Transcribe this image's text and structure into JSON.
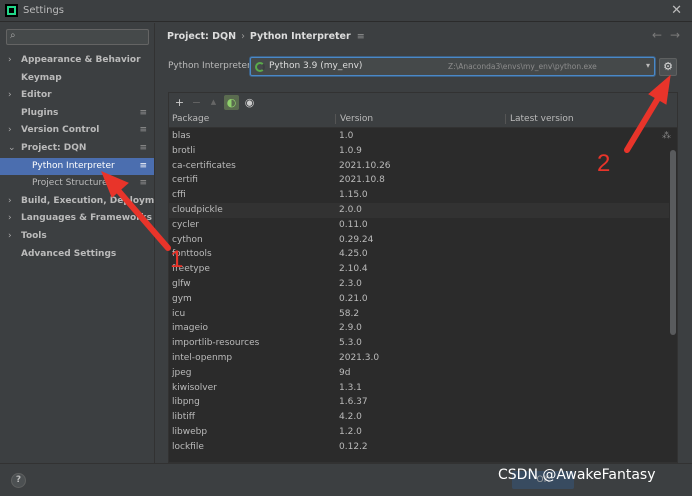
{
  "window": {
    "title": "Settings",
    "close_glyph": "✕"
  },
  "sidebar": {
    "search_placeholder": "",
    "items": [
      {
        "label": "Appearance & Behavior",
        "arrow": "›",
        "page_icon": ""
      },
      {
        "label": "Keymap",
        "arrow": "",
        "page_icon": ""
      },
      {
        "label": "Editor",
        "arrow": "›",
        "page_icon": ""
      },
      {
        "label": "Plugins",
        "arrow": "",
        "page_icon": "≡"
      },
      {
        "label": "Version Control",
        "arrow": "›",
        "page_icon": "≡"
      },
      {
        "label": "Project: DQN",
        "arrow": "⌄",
        "page_icon": "≡"
      },
      {
        "label": "Python Interpreter",
        "arrow": "",
        "page_icon": "≡",
        "child": true,
        "selected": true
      },
      {
        "label": "Project Structure",
        "arrow": "",
        "page_icon": "≡",
        "child": true
      },
      {
        "label": "Build, Execution, Deployment",
        "arrow": "›",
        "page_icon": ""
      },
      {
        "label": "Languages & Frameworks",
        "arrow": "›",
        "page_icon": ""
      },
      {
        "label": "Tools",
        "arrow": "›",
        "page_icon": ""
      },
      {
        "label": "Advanced Settings",
        "arrow": "",
        "page_icon": ""
      }
    ]
  },
  "breadcrumb": {
    "project": "Project: DQN",
    "separator": "›",
    "page": "Python Interpreter",
    "page_icon": "≡"
  },
  "nav": {
    "back": "←",
    "forward": "→"
  },
  "interpreter": {
    "label": "Python Interpreter:",
    "name": "Python 3.9 (my_env)",
    "path": "Z:\\Anaconda3\\envs\\my_env\\python.exe",
    "dropdown_glyph": "▾",
    "settings_glyph": "⚙"
  },
  "toolbar": {
    "add": "+",
    "remove": "−",
    "upgrade": "▲",
    "conda": "◐",
    "show": "◉"
  },
  "table": {
    "columns": [
      "Package",
      "Version",
      "Latest version"
    ],
    "rows": [
      [
        "blas",
        "1.0",
        ""
      ],
      [
        "brotli",
        "1.0.9",
        ""
      ],
      [
        "ca-certificates",
        "2021.10.26",
        ""
      ],
      [
        "certifi",
        "2021.10.8",
        ""
      ],
      [
        "cffi",
        "1.15.0",
        ""
      ],
      [
        "cloudpickle",
        "2.0.0",
        ""
      ],
      [
        "cycler",
        "0.11.0",
        ""
      ],
      [
        "cython",
        "0.29.24",
        ""
      ],
      [
        "fonttools",
        "4.25.0",
        ""
      ],
      [
        "freetype",
        "2.10.4",
        ""
      ],
      [
        "glfw",
        "2.3.0",
        ""
      ],
      [
        "gym",
        "0.21.0",
        ""
      ],
      [
        "icu",
        "58.2",
        ""
      ],
      [
        "imageio",
        "2.9.0",
        ""
      ],
      [
        "importlib-resources",
        "5.3.0",
        ""
      ],
      [
        "intel-openmp",
        "2021.3.0",
        ""
      ],
      [
        "jpeg",
        "9d",
        ""
      ],
      [
        "kiwisolver",
        "1.3.1",
        ""
      ],
      [
        "libpng",
        "1.6.37",
        ""
      ],
      [
        "libtiff",
        "4.2.0",
        ""
      ],
      [
        "libwebp",
        "1.2.0",
        ""
      ],
      [
        "lockfile",
        "0.12.2",
        ""
      ]
    ],
    "highlighted_row": 5,
    "loading_glyph": "⁂"
  },
  "footer": {
    "help": "?",
    "ok": "OK"
  },
  "annotations": {
    "num1": "1",
    "num2": "2",
    "color": "#e8342a"
  },
  "watermark": "CSDN @AwakeFantasy"
}
